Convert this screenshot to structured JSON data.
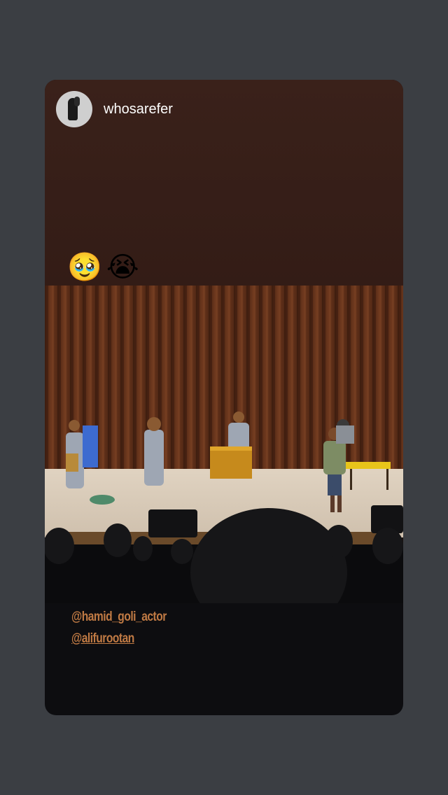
{
  "story": {
    "username": "whosarefer",
    "emojis": [
      "🥹",
      "😭"
    ],
    "mentions": [
      "@hamid_goli_actor",
      "@alifurootan"
    ]
  },
  "colors": {
    "background": "#3b3e43",
    "top_band": "#3a211a",
    "mention_text": "#c07a44"
  },
  "icons": {
    "avatar": "profile-avatar"
  }
}
